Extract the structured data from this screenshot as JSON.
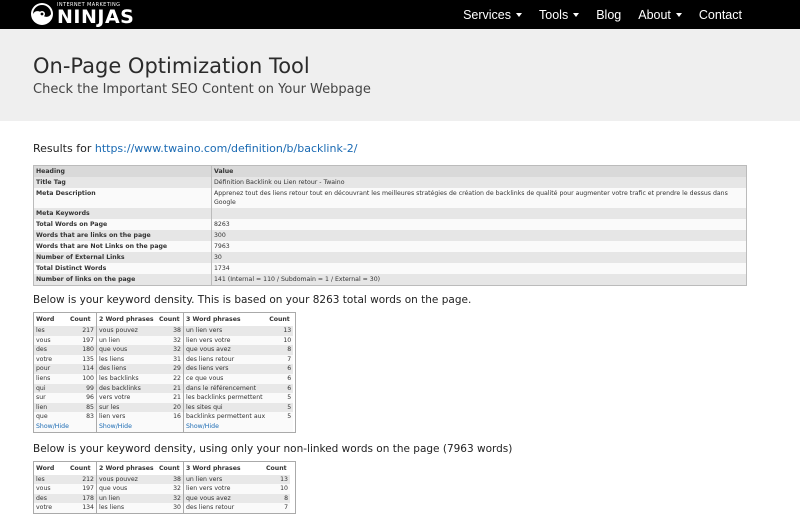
{
  "nav": {
    "logo_small": "INTERNET MARKETING",
    "logo_big": "NINJAS",
    "items": [
      {
        "label": "Services",
        "dropdown": true
      },
      {
        "label": "Tools",
        "dropdown": true
      },
      {
        "label": "Blog",
        "dropdown": false
      },
      {
        "label": "About",
        "dropdown": true
      },
      {
        "label": "Contact",
        "dropdown": false
      }
    ]
  },
  "hero": {
    "title": "On-Page Optimization Tool",
    "subtitle": "Check the Important SEO Content on Your Webpage"
  },
  "results": {
    "prefix": "Results for",
    "url": "https://www.twaino.com/definition/b/backlink-2/"
  },
  "info_table": {
    "headers": [
      "Heading",
      "Value"
    ],
    "rows": [
      [
        "Title Tag",
        "Définition Backlink ou Lien retour - Twaino"
      ],
      [
        "Meta Description",
        "Apprenez tout des liens retour tout en découvrant les meilleures stratégies de création de backlinks de qualité pour augmenter votre trafic et prendre le dessus dans Google"
      ],
      [
        "Meta Keywords",
        ""
      ],
      [
        "Total Words on Page",
        "8263"
      ],
      [
        "Words that are links on the page",
        "300"
      ],
      [
        "Words that are Not Links on the page",
        "7963"
      ],
      [
        "Number of External Links",
        "30"
      ],
      [
        "Total Distinct Words",
        "1734"
      ],
      [
        "Number of links on the page",
        "141 (Internal = 110 / Subdomain = 1 / External = 30)"
      ]
    ]
  },
  "density1": {
    "title": "Below is your keyword density. This is based on your 8263 total words on the page.",
    "word_headers": [
      "Word",
      "Count"
    ],
    "two_headers": [
      "2 Word phrases",
      "Count"
    ],
    "three_headers": [
      "3 Word phrases",
      "Count"
    ],
    "words": [
      [
        "les",
        "217"
      ],
      [
        "vous",
        "197"
      ],
      [
        "des",
        "180"
      ],
      [
        "votre",
        "135"
      ],
      [
        "pour",
        "114"
      ],
      [
        "liens",
        "100"
      ],
      [
        "qui",
        "99"
      ],
      [
        "sur",
        "96"
      ],
      [
        "lien",
        "85"
      ],
      [
        "que",
        "83"
      ]
    ],
    "two": [
      [
        "vous pouvez",
        "38"
      ],
      [
        "un lien",
        "32"
      ],
      [
        "que vous",
        "32"
      ],
      [
        "les liens",
        "31"
      ],
      [
        "des liens",
        "29"
      ],
      [
        "les backlinks",
        "22"
      ],
      [
        "des backlinks",
        "21"
      ],
      [
        "vers votre",
        "21"
      ],
      [
        "sur les",
        "20"
      ],
      [
        "lien vers",
        "16"
      ]
    ],
    "three": [
      [
        "un lien vers",
        "13"
      ],
      [
        "lien vers votre",
        "10"
      ],
      [
        "que vous avez",
        "8"
      ],
      [
        "des liens retour",
        "7"
      ],
      [
        "des liens vers",
        "6"
      ],
      [
        "ce que vous",
        "6"
      ],
      [
        "dans le référencement",
        "6"
      ],
      [
        "les backlinks permettent",
        "5"
      ],
      [
        "les sites qui",
        "5"
      ],
      [
        "backlinks permettent aux",
        "5"
      ]
    ],
    "show_hide": "Show/Hide"
  },
  "density2": {
    "title": "Below is your keyword density, using only your non-linked words on the page (7963 words)",
    "word_headers": [
      "Word",
      "Count"
    ],
    "two_headers": [
      "2 Word phrases",
      "Count"
    ],
    "three_headers": [
      "3 Word phrases",
      "Count"
    ],
    "words": [
      [
        "les",
        "212"
      ],
      [
        "vous",
        "197"
      ],
      [
        "des",
        "178"
      ],
      [
        "votre",
        "134"
      ]
    ],
    "two": [
      [
        "vous pouvez",
        "38"
      ],
      [
        "que vous",
        "32"
      ],
      [
        "un lien",
        "32"
      ],
      [
        "les liens",
        "30"
      ]
    ],
    "three": [
      [
        "un lien vers",
        "13"
      ],
      [
        "lien vers votre",
        "10"
      ],
      [
        "que vous avez",
        "8"
      ],
      [
        "des liens retour",
        "7"
      ]
    ]
  }
}
